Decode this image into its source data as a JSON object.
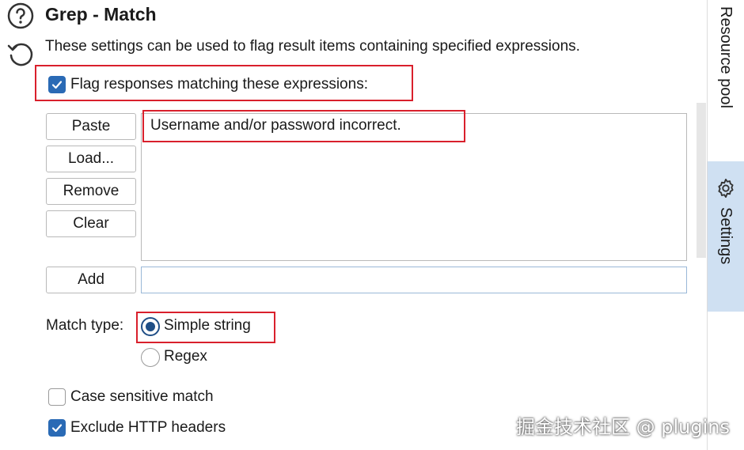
{
  "header": {
    "title": "Grep - Match",
    "description": "These settings can be used to flag result items containing specified expressions."
  },
  "flag": {
    "label": "Flag responses matching these expressions:",
    "checked": true
  },
  "buttons": {
    "paste": "Paste",
    "load": "Load...",
    "remove": "Remove",
    "clear": "Clear",
    "add": "Add"
  },
  "expressions": [
    "Username and/or password incorrect."
  ],
  "add_input": {
    "value": ""
  },
  "match_type": {
    "label": "Match type:",
    "options": [
      "Simple string",
      "Regex"
    ],
    "selected": "Simple string"
  },
  "options": {
    "case_sensitive": {
      "label": "Case sensitive match",
      "checked": false
    },
    "exclude_headers": {
      "label": "Exclude HTTP headers",
      "checked": true
    }
  },
  "sidebar": {
    "tabs": [
      {
        "label": "Resource pool",
        "icon": "none",
        "active": false
      },
      {
        "label": "Settings",
        "icon": "gear-icon",
        "active": true
      }
    ]
  },
  "watermark": "掘金技术社区 @ plugins",
  "colors": {
    "accent": "#2a6ab5",
    "highlight": "#d9202c",
    "active_tab": "#cfe0f2"
  }
}
